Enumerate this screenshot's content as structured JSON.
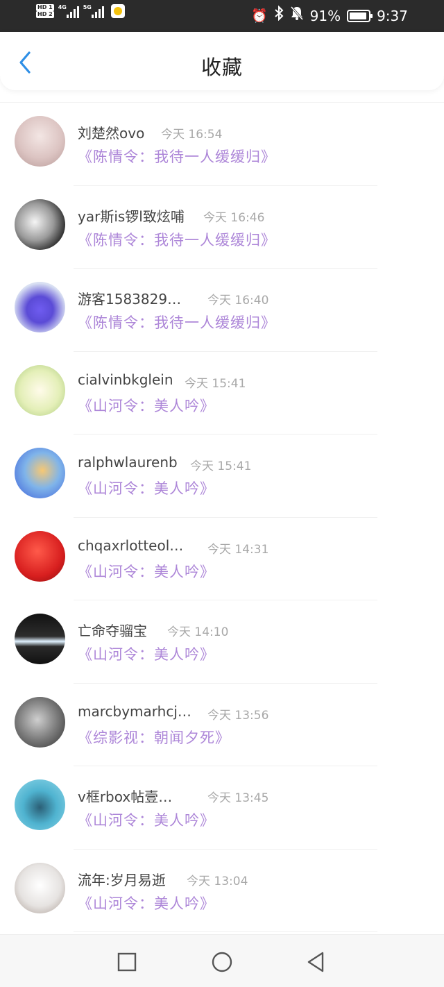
{
  "status_bar": {
    "hd1": "HD 1",
    "hd2": "HD 2",
    "net1": "4G",
    "net2": "5G",
    "battery_percent": "91%",
    "battery_level": 0.91,
    "time": "9:37",
    "icons": [
      "alarm-icon",
      "bluetooth-icon",
      "mute-bell-icon",
      "battery-icon"
    ]
  },
  "header": {
    "title": "收藏",
    "back_icon": "chevron-left-icon",
    "accent_color": "#2f8fe6"
  },
  "colors": {
    "work_title": "#ad86d8",
    "time_text": "#a8a8a8"
  },
  "items": [
    {
      "name": "刘楚然ovo",
      "time": "今天 16:54",
      "work": "《陈情令：我待一人缓缓归》"
    },
    {
      "name": "yar斯is锣l致炫哺",
      "time": "今天 16:46",
      "work": "《陈情令：我待一人缓缓归》"
    },
    {
      "name": "游客1583829…",
      "time": "今天 16:40",
      "work": "《陈情令：我待一人缓缓归》"
    },
    {
      "name": "cialvinbkglein",
      "time": "今天 15:41",
      "work": "《山河令：美人吟》"
    },
    {
      "name": "ralphwlaurenb",
      "time": "今天 15:41",
      "work": "《山河令：美人吟》"
    },
    {
      "name": "chqaxrlotteol…",
      "time": "今天 14:31",
      "work": "《山河令：美人吟》"
    },
    {
      "name": "亡命夺骝宝",
      "time": "今天 14:10",
      "work": "《山河令：美人吟》"
    },
    {
      "name": "marcbymarhcj…",
      "time": "今天 13:56",
      "work": "《综影视：朝闻夕死》"
    },
    {
      "name": "v框rbox帖壹…",
      "time": "今天 13:45",
      "work": "《山河令：美人吟》"
    },
    {
      "name": "流年:岁月易逝",
      "time": "今天 13:04",
      "work": "《山河令：美人吟》"
    }
  ],
  "nav_bar": {
    "icons": [
      "recent-apps-square-icon",
      "home-circle-icon",
      "back-triangle-icon"
    ]
  }
}
